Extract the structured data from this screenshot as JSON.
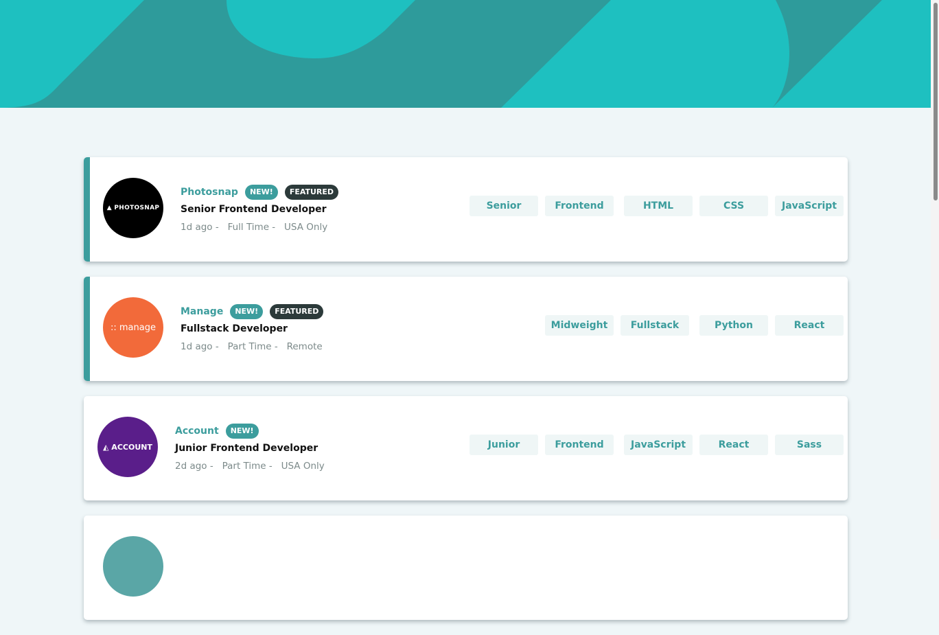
{
  "colors": {
    "header": "#1ec0c0",
    "accent": "#3c9d9d",
    "featured_badge": "#2c3a3a",
    "tag_bg": "#eff6f6"
  },
  "jobs": [
    {
      "company": "Photosnap",
      "logo_text": "▲ PHOTOSNAP",
      "logo_color": "#000000",
      "new": "NEW!",
      "featured": "FEATURED",
      "position": "Senior Frontend Developer",
      "meta": "1d ago -   Full Time -   USA Only",
      "tags": [
        "Senior",
        "Frontend",
        "HTML",
        "CSS",
        "JavaScript"
      ]
    },
    {
      "company": "Manage",
      "logo_text": ":: manage",
      "logo_color": "#f26a3a",
      "new": "NEW!",
      "featured": "FEATURED",
      "position": "Fullstack Developer",
      "meta": "1d ago -   Part Time -   Remote",
      "tags": [
        "Midweight",
        "Fullstack",
        "Python",
        "React"
      ]
    },
    {
      "company": "Account",
      "logo_text": "◭ ACCOUNT",
      "logo_color": "#5a1e8a",
      "new": "NEW!",
      "position": "Junior Frontend Developer",
      "meta": "2d ago -   Part Time -   USA Only",
      "tags": [
        "Junior",
        "Frontend",
        "JavaScript",
        "React",
        "Sass"
      ]
    }
  ]
}
